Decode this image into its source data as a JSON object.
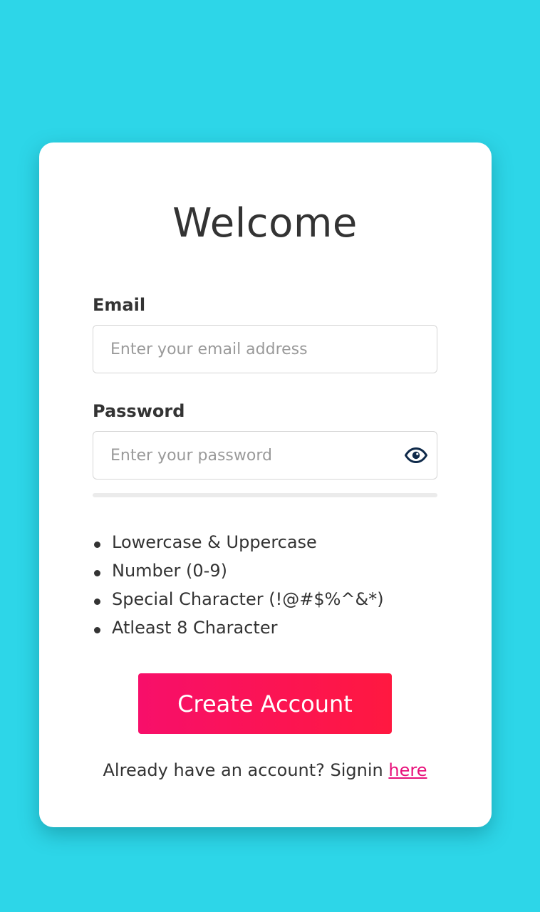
{
  "card": {
    "title": "Welcome",
    "email": {
      "label": "Email",
      "placeholder": "Enter your email address",
      "value": ""
    },
    "password": {
      "label": "Password",
      "placeholder": "Enter your password",
      "value": "",
      "toggle_icon": "eye-icon"
    },
    "strength": {
      "level": 0
    },
    "requirements": [
      "Lowercase & Uppercase",
      "Number (0-9)",
      "Special Character (!@#$%^&*)",
      "Atleast 8 Character"
    ],
    "create_button_label": "Create Account",
    "signin_prompt": "Already have an account? Signin",
    "signin_link_label": "here"
  },
  "colors": {
    "background": "#2dd6e8",
    "card": "#ffffff",
    "button_gradient_start": "#f70f6a",
    "button_gradient_end": "#ff1840",
    "link": "#e8107a",
    "eye_icon": "#0f2a4a"
  }
}
